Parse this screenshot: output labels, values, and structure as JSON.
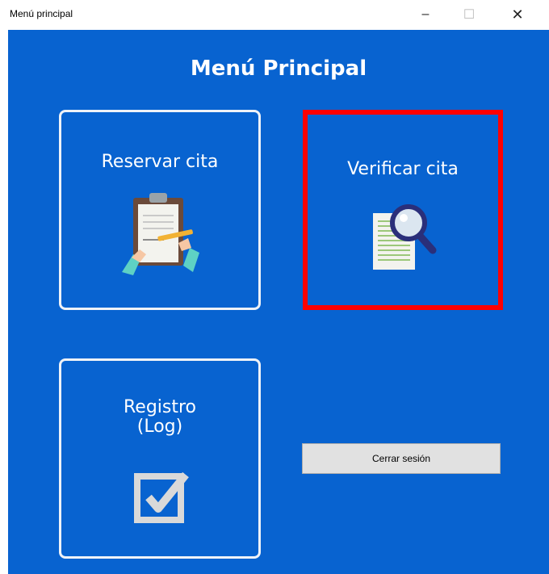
{
  "window": {
    "title": "Menú principal",
    "minimize": "–",
    "maximize": "☐",
    "close": "✕"
  },
  "menu": {
    "heading": "Menú Principal",
    "tiles": {
      "reservar": {
        "label": "Reservar cita",
        "icon": "clipboard-writing-icon"
      },
      "verificar": {
        "label": "Verificar cita",
        "icon": "document-search-icon"
      },
      "registro": {
        "label_line1": "Registro",
        "label_line2": "(Log)",
        "icon": "checkbox-checked-icon"
      }
    },
    "logout_label": "Cerrar sesión"
  },
  "colors": {
    "background": "#0863d0",
    "highlight_border": "#ff0000",
    "tile_border": "#eef2f8"
  }
}
